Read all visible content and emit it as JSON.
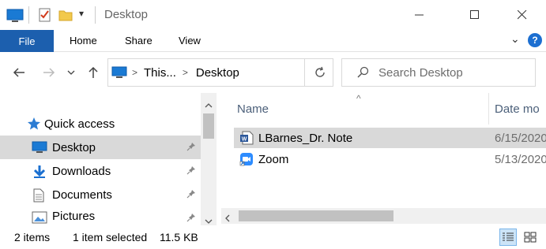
{
  "window": {
    "title": "Desktop",
    "qat_dropdown": "▾"
  },
  "ribbon": {
    "tabs": [
      "File",
      "Home",
      "Share",
      "View"
    ],
    "help_label": "?",
    "collapse_glyph": "⌄"
  },
  "nav": {
    "breadcrumb": [
      "This...",
      "Desktop"
    ],
    "search_placeholder": "Search Desktop"
  },
  "navpane": {
    "quick_access_label": "Quick access",
    "items": [
      {
        "label": "Desktop",
        "icon": "desktop-icon",
        "pinned": true,
        "selected": true
      },
      {
        "label": "Downloads",
        "icon": "downloads-icon",
        "pinned": true,
        "selected": false
      },
      {
        "label": "Documents",
        "icon": "documents-icon",
        "pinned": true,
        "selected": false
      },
      {
        "label": "Pictures",
        "icon": "pictures-icon",
        "pinned": true,
        "selected": false
      }
    ]
  },
  "content": {
    "columns": [
      "Name",
      "Date mo"
    ],
    "sort_indicator": "^",
    "files": [
      {
        "name": "LBarnes_Dr. Note",
        "date": "6/15/2020",
        "icon": "word-doc-icon",
        "selected": true
      },
      {
        "name": "Zoom",
        "date": "5/13/2020",
        "icon": "zoom-shortcut-icon",
        "selected": false
      }
    ]
  },
  "status": {
    "item_count": "2 items",
    "selection": "1 item selected",
    "size": "11.5 KB"
  },
  "colors": {
    "file_tab": "#1c5fae",
    "accent": "#0078d7",
    "selection": "#d9d9d9"
  }
}
